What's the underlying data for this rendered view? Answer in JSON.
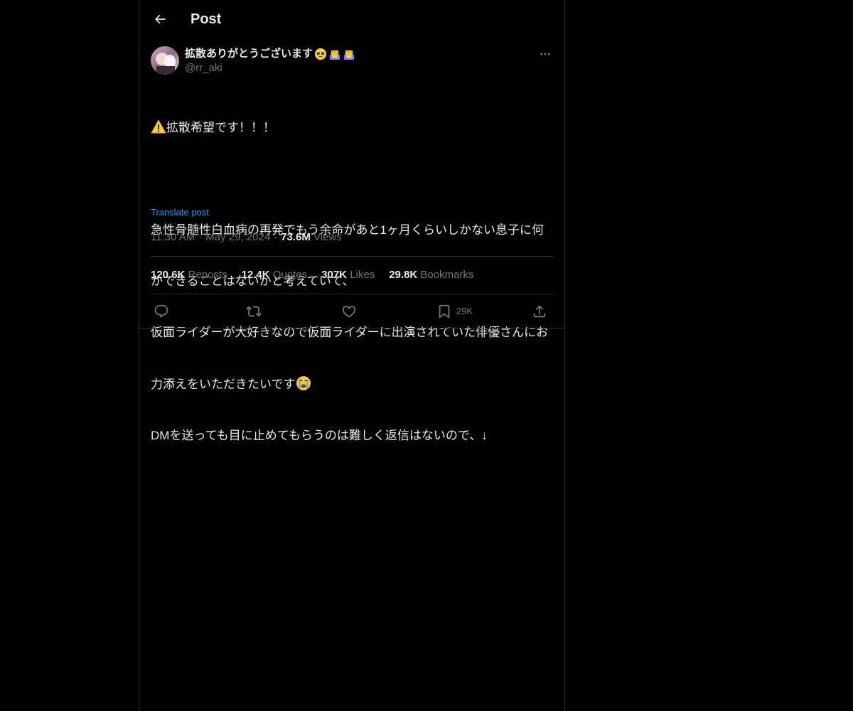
{
  "header": {
    "title": "Post",
    "back_icon": "arrow-left-icon"
  },
  "author": {
    "display_name": "拡散ありがとうございます",
    "name_emojis": [
      "pleading-face-emoji",
      "person-bowing-emoji",
      "person-bowing-emoji"
    ],
    "handle": "@rr_aki"
  },
  "post": {
    "lines": [
      "拡散希望です！！！",
      "",
      "急性骨髄性白血病の再発でもう余命があと1ヶ月くらいしかない息子に何",
      "かできることはないかと考えていて、",
      "仮面ライダーが大好きなので仮面ライダーに出演されていた俳優さんにお",
      "力添えをいただきたいです",
      "DMを送っても目に止めてもらうのは難しく返信はないので、↓"
    ],
    "line1_emoji": "warning-emoji",
    "line6_emoji": "loudly-crying-face-emoji",
    "translate_label": "Translate post"
  },
  "meta": {
    "time": "11:30 AM",
    "separator": "·",
    "date": "May 29, 2024",
    "views_count": "73.6M",
    "views_label": "Views"
  },
  "stats": {
    "reposts_count": "120.6K",
    "reposts_label": "Reposts",
    "quotes_count": "12.4K",
    "quotes_label": "Quotes",
    "likes_count": "307K",
    "likes_label": "Likes",
    "bookmarks_count": "29.8K",
    "bookmarks_label": "Bookmarks"
  },
  "actions": {
    "reply_icon": "reply-icon",
    "repost_icon": "repost-icon",
    "like_icon": "heart-icon",
    "bookmark_icon": "bookmark-icon",
    "bookmark_count": "29K",
    "share_icon": "share-icon"
  },
  "colors": {
    "background": "#000000",
    "text": "#e7e9ea",
    "muted": "#71767b",
    "accent": "#1d9bf0",
    "border": "#2f3336"
  }
}
